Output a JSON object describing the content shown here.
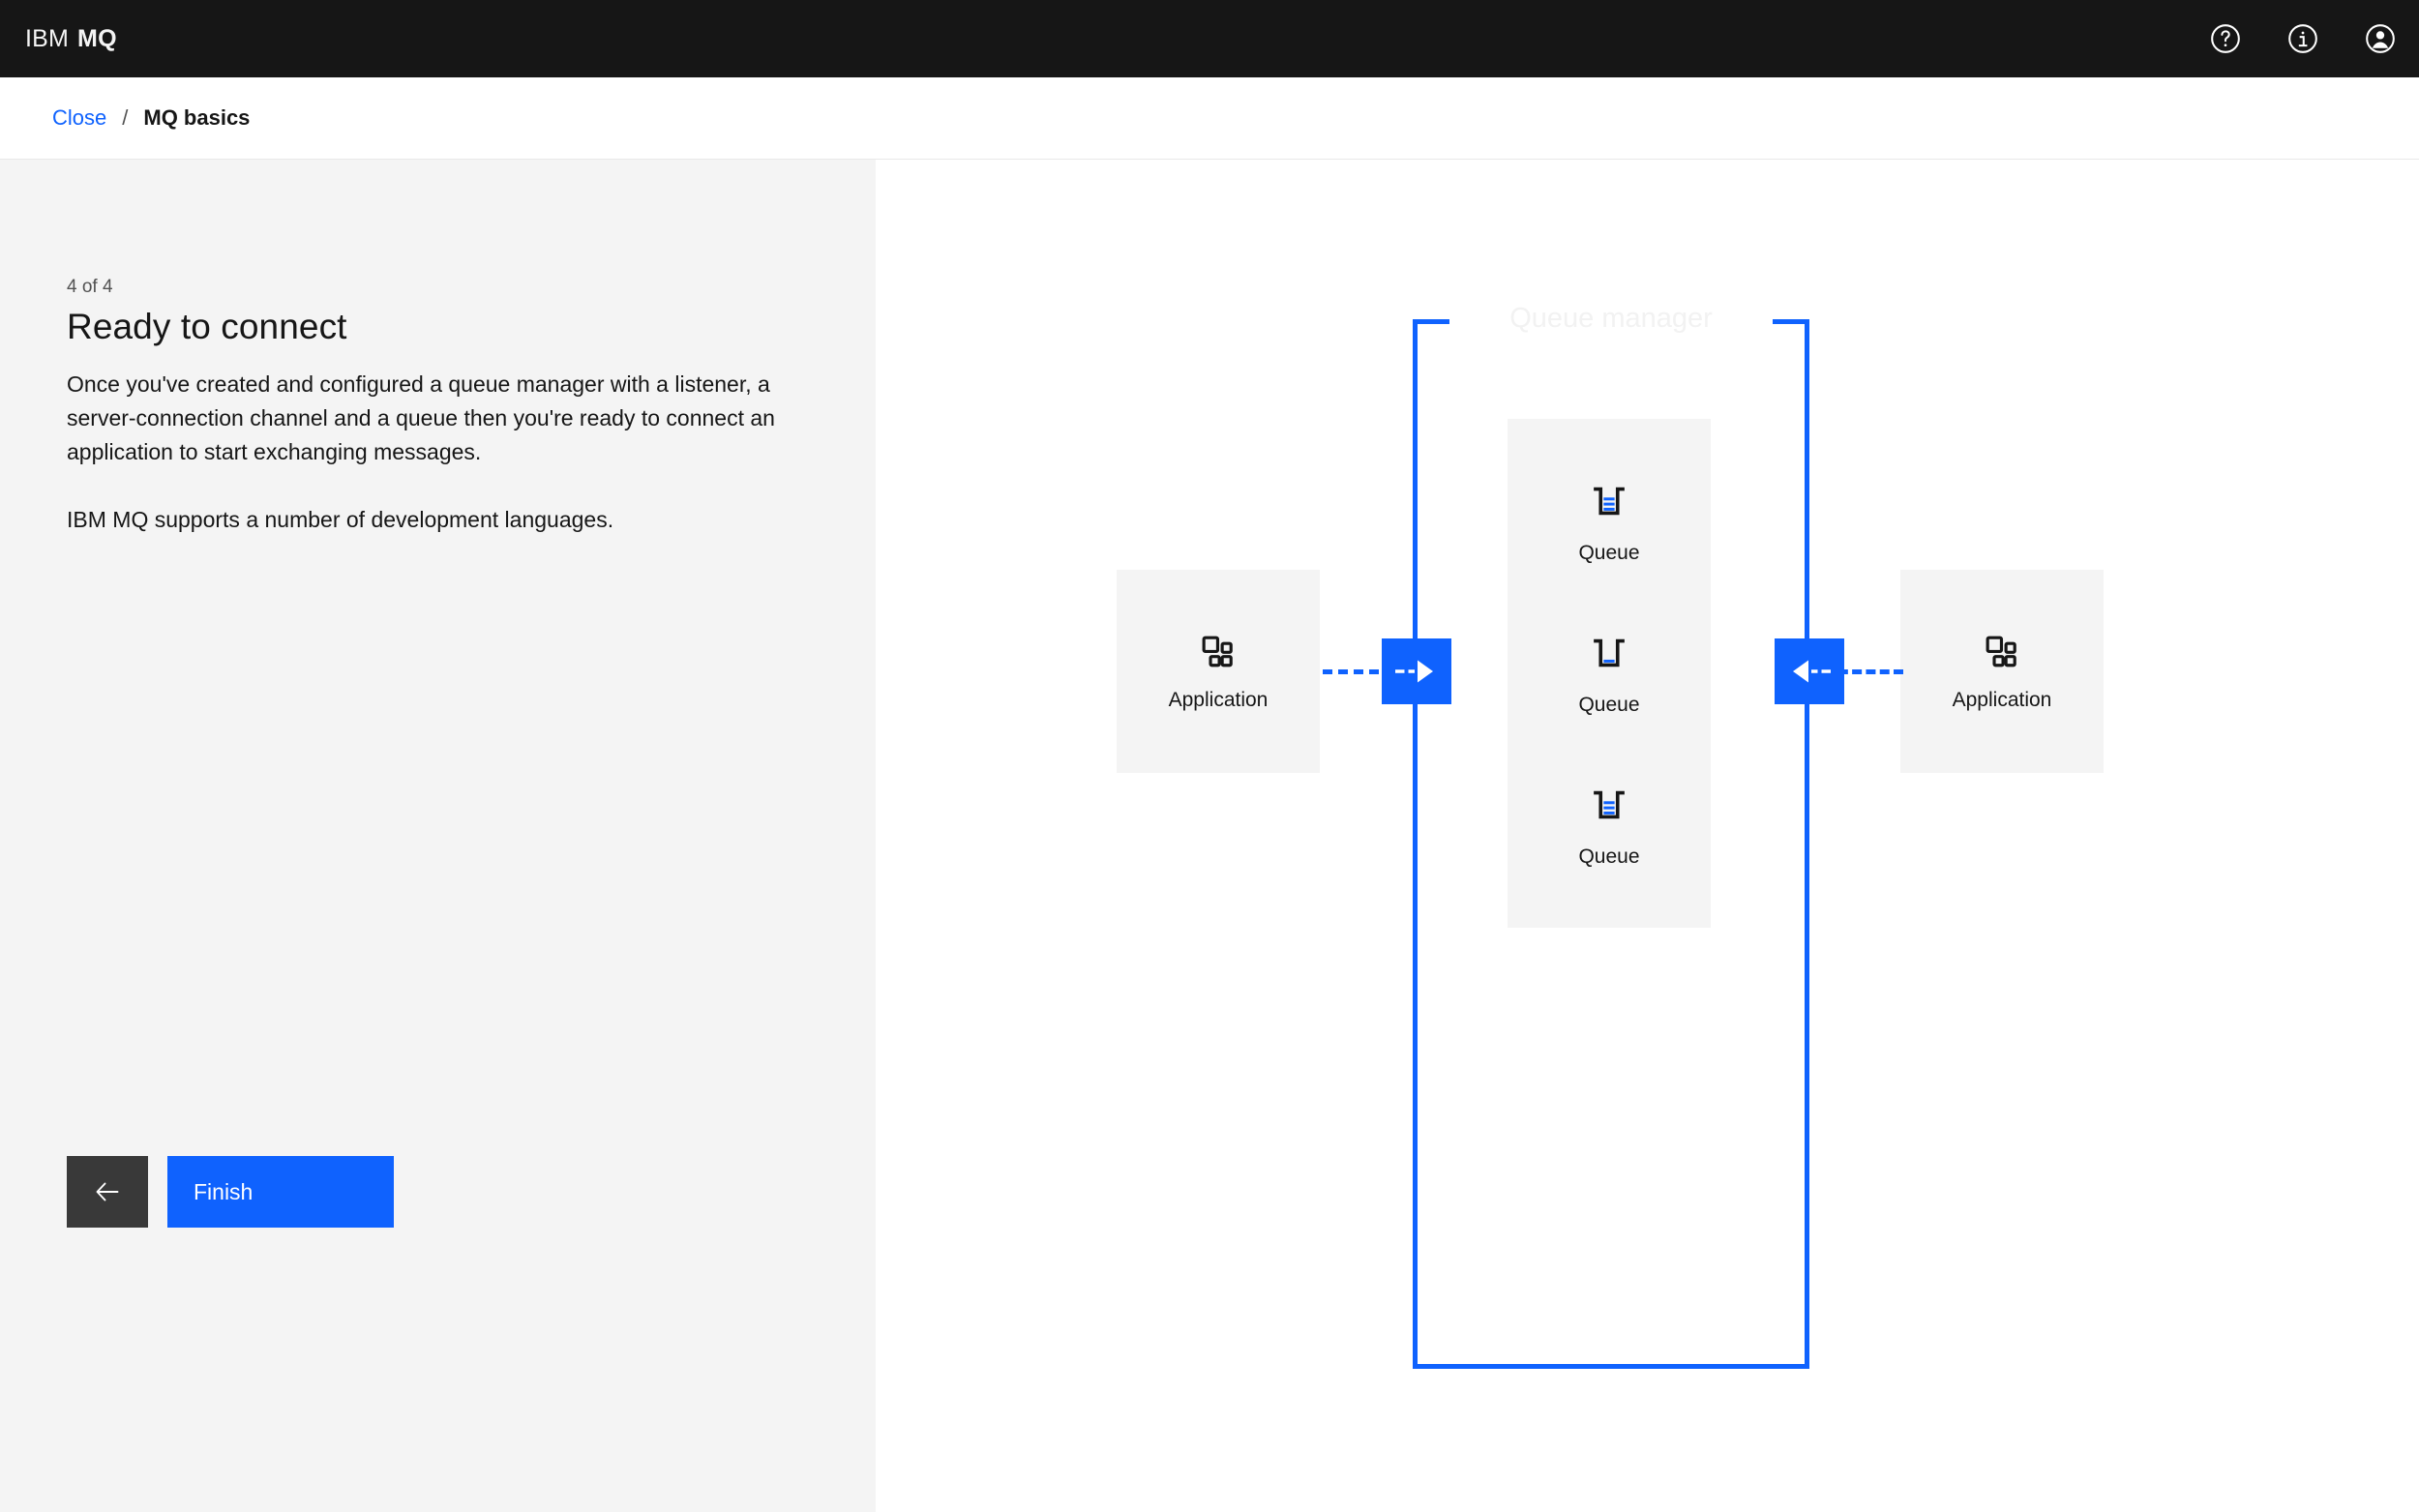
{
  "header": {
    "brand_prefix": "IBM",
    "brand_product": "MQ",
    "actions": [
      {
        "name": "help-icon",
        "label": "Help"
      },
      {
        "name": "information-icon",
        "label": "Information"
      },
      {
        "name": "user-avatar-icon",
        "label": "User profile"
      }
    ]
  },
  "breadcrumb": {
    "close_label": "Close",
    "separator": "/",
    "current": "MQ basics"
  },
  "panel": {
    "step_counter": "4 of 4",
    "title": "Ready to connect",
    "paragraph_1": "Once you've created and configured a queue manager with a listener, a server-connection channel and a queue then you're ready to connect an application to start exchanging messages.",
    "paragraph_2": "IBM MQ supports a number of development languages.",
    "back_label": "Back",
    "finish_label": "Finish"
  },
  "diagram": {
    "queue_manager_label": "Queue manager",
    "app_left_label": "Application",
    "app_right_label": "Application",
    "queue_1_label": "Queue",
    "queue_2_label": "Queue",
    "queue_3_label": "Queue",
    "inbound_channel_label": "Inbound channel",
    "outbound_channel_label": "Outbound channel"
  },
  "colors": {
    "brand_blue": "#0f62fe",
    "header_black": "#161616",
    "panel_gray": "#f4f4f4",
    "back_button_gray": "#393939",
    "queue_manager_label_gray": "#f2f2f2"
  }
}
